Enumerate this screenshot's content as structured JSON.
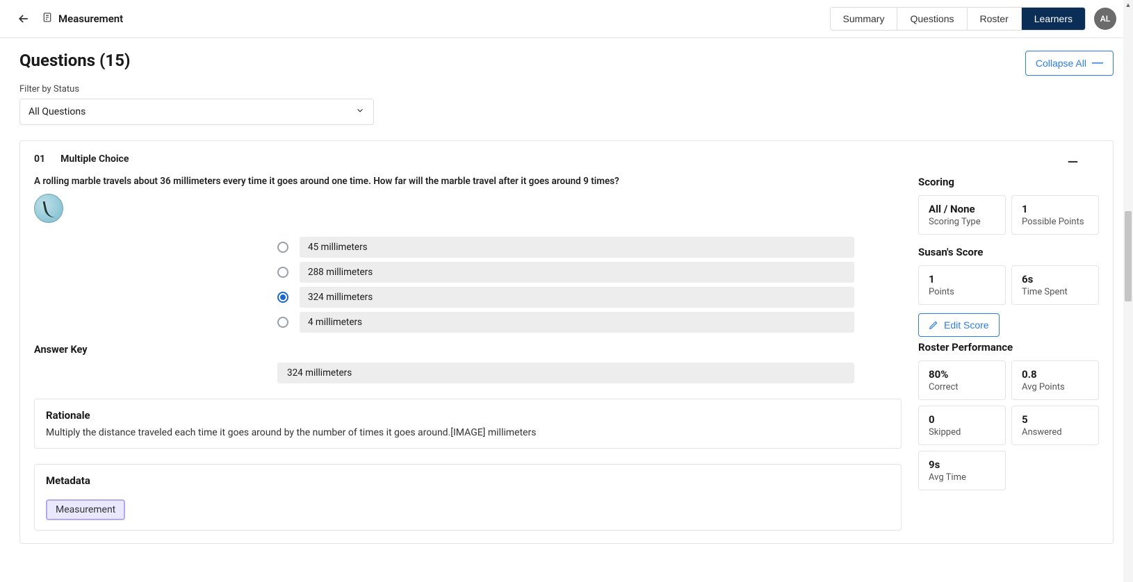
{
  "header": {
    "title": "Measurement",
    "tabs": [
      "Summary",
      "Questions",
      "Roster",
      "Learners"
    ],
    "active_tab_index": 3,
    "avatar_initials": "AL"
  },
  "page": {
    "questions_title": "Questions (15)",
    "collapse_label": "Collapse All",
    "filter_label": "Filter by Status",
    "filter_value": "All Questions"
  },
  "question": {
    "number": "01",
    "type": "Multiple Choice",
    "prompt": "A rolling marble travels about 36 millimeters every time it goes around one time. How far will the marble travel after it goes around 9 times?",
    "options": [
      {
        "text": "45 millimeters",
        "selected": false
      },
      {
        "text": "288 millimeters",
        "selected": false
      },
      {
        "text": "324 millimeters",
        "selected": true
      },
      {
        "text": "4 millimeters",
        "selected": false
      }
    ],
    "answer_key_label": "Answer Key",
    "answer_key": "324 millimeters",
    "rationale_title": "Rationale",
    "rationale_text": "Multiply the distance traveled each time it goes around by the number of times it goes around.[IMAGE] millimeters",
    "metadata_title": "Metadata",
    "metadata_tag": "Measurement"
  },
  "scoring": {
    "section_title": "Scoring",
    "scoring_type_val": "All / None",
    "scoring_type_label": "Scoring Type",
    "possible_points_val": "1",
    "possible_points_label": "Possible Points",
    "learner_score_title": "Susan's Score",
    "points_val": "1",
    "points_label": "Points",
    "time_val": "6s",
    "time_label": "Time Spent",
    "edit_score_label": "Edit Score",
    "roster_title": "Roster Performance",
    "correct_val": "80%",
    "correct_label": "Correct",
    "avg_points_val": "0.8",
    "avg_points_label": "Avg Points",
    "skipped_val": "0",
    "skipped_label": "Skipped",
    "answered_val": "5",
    "answered_label": "Answered",
    "avg_time_val": "9s",
    "avg_time_label": "Avg Time"
  }
}
